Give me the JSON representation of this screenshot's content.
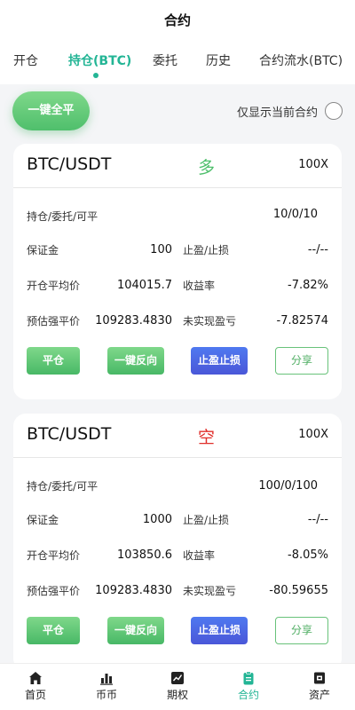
{
  "header": {
    "title": "合约"
  },
  "tabs": [
    {
      "label": "开仓"
    },
    {
      "label": "持仓(BTC)"
    },
    {
      "label": "委托"
    },
    {
      "label": "历史"
    },
    {
      "label": "合约流水(BTC)"
    }
  ],
  "toolbar": {
    "close_all": "一键全平",
    "only_current": "仅显示当前合约"
  },
  "positions": [
    {
      "pair": "BTC/USDT",
      "side": "多",
      "leverage": "100X",
      "hold_label": "持仓/委托/可平",
      "hold_value": "10/0/10",
      "margin_label": "保证金",
      "margin_value": "100",
      "tpsl_label": "止盈/止损",
      "tpsl_value": "--/--",
      "entry_label": "开仓平均价",
      "entry_value": "104015.7",
      "roe_label": "收益率",
      "roe_value": "-7.82%",
      "liq_label": "预估强平价",
      "liq_value": "109283.4830",
      "pnl_label": "未实现盈亏",
      "pnl_value": "-7.82574",
      "btn_close": "平仓",
      "btn_reverse": "一键反向",
      "btn_tpsl": "止盈止损",
      "btn_share": "分享"
    },
    {
      "pair": "BTC/USDT",
      "side": "空",
      "leverage": "100X",
      "hold_label": "持仓/委托/可平",
      "hold_value": "100/0/100",
      "margin_label": "保证金",
      "margin_value": "1000",
      "tpsl_label": "止盈/止损",
      "tpsl_value": "--/--",
      "entry_label": "开仓平均价",
      "entry_value": "103850.6",
      "roe_label": "收益率",
      "roe_value": "-8.05%",
      "liq_label": "预估强平价",
      "liq_value": "109283.4830",
      "pnl_label": "未实现盈亏",
      "pnl_value": "-80.59655",
      "btn_close": "平仓",
      "btn_reverse": "一键反向",
      "btn_tpsl": "止盈止损",
      "btn_share": "分享"
    }
  ],
  "bottom_nav": [
    {
      "label": "首页",
      "icon": "home-icon"
    },
    {
      "label": "币币",
      "icon": "bar-chart-icon"
    },
    {
      "label": "期权",
      "icon": "trend-chart-icon"
    },
    {
      "label": "合约",
      "icon": "contract-clipboard-icon"
    },
    {
      "label": "资产",
      "icon": "wallet-icon"
    }
  ],
  "colors": {
    "accent": "#23b595",
    "long": "#4fbf6c",
    "short": "#e0302c",
    "blue_button": "#4a57d8"
  }
}
